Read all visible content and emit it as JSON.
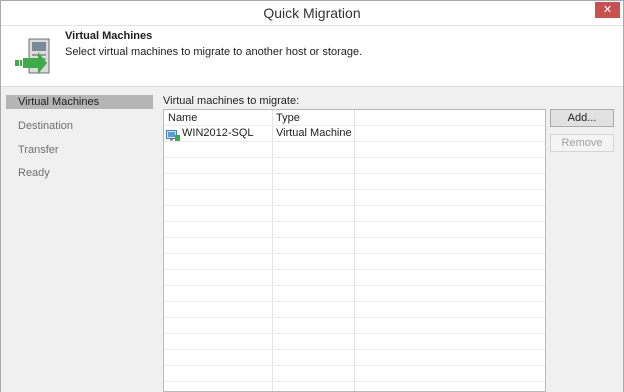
{
  "window": {
    "title": "Quick Migration",
    "close_glyph": "✕"
  },
  "header": {
    "icon": "vm-migration-icon",
    "title": "Virtual Machines",
    "subtitle": "Select virtual machines to migrate to another host or storage."
  },
  "steps": [
    {
      "label": "Virtual Machines",
      "active": true
    },
    {
      "label": "Destination",
      "active": false
    },
    {
      "label": "Transfer",
      "active": false
    },
    {
      "label": "Ready",
      "active": false
    }
  ],
  "vm_list": {
    "label": "Virtual machines to migrate:",
    "columns": [
      "Name",
      "Type"
    ],
    "rows": [
      {
        "name": "WIN2012-SQL",
        "type": "Virtual Machine",
        "icon": "virtual-machine-icon"
      }
    ]
  },
  "buttons": {
    "add": "Add...",
    "remove": "Remove"
  },
  "colors": {
    "active_step_bg": "#b5b5b5",
    "close_button": "#c75050",
    "icon_green": "#3faa49"
  }
}
